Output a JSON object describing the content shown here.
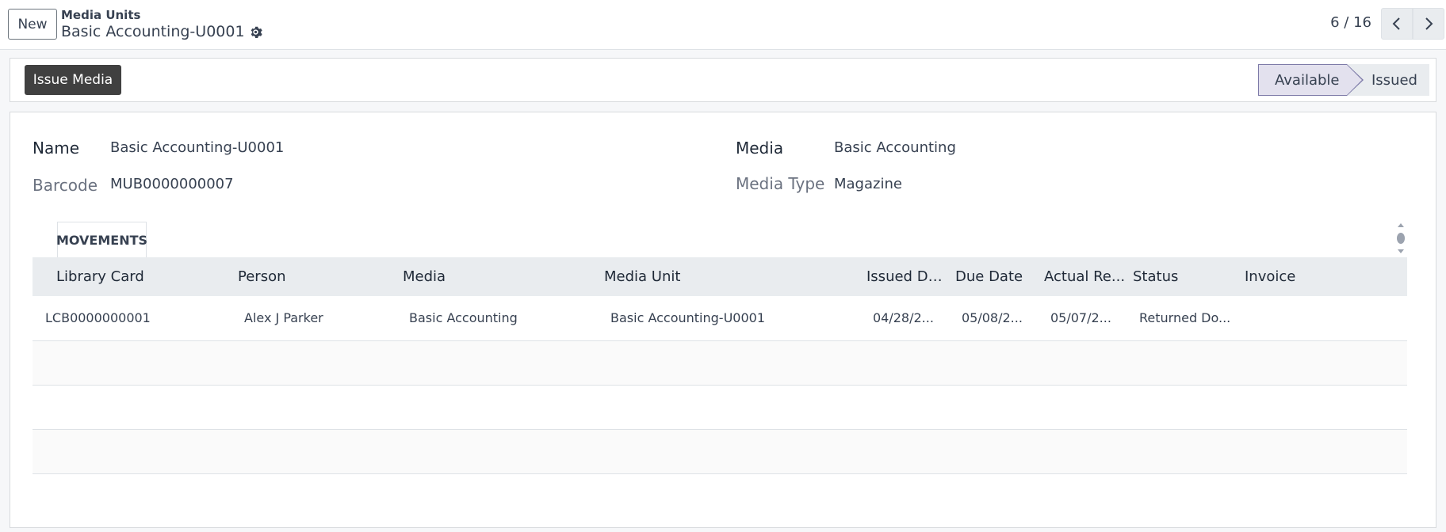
{
  "control_panel": {
    "new_label": "New",
    "breadcrumb_parent": "Media Units",
    "breadcrumb_current": "Basic Accounting-U0001",
    "pager_value": "6 / 16"
  },
  "statusbar": {
    "action_label": "Issue Media",
    "stages": [
      "Available",
      "Issued"
    ],
    "current_stage": "Available"
  },
  "form": {
    "name_label": "Name",
    "name_value": "Basic Accounting-U0001",
    "barcode_label": "Barcode",
    "barcode_value": "MUB0000000007",
    "media_label": "Media",
    "media_value": "Basic Accounting",
    "media_type_label": "Media Type",
    "media_type_value": "Magazine"
  },
  "notebook": {
    "tab_label": "MOVEMENTS",
    "columns": [
      "Library Card",
      "Person",
      "Media",
      "Media Unit",
      "Issued Da...",
      "Due Date",
      "Actual Re...",
      "Status",
      "Invoice"
    ],
    "rows": [
      [
        "LCB0000000001",
        "Alex J Parker",
        "Basic Accounting",
        "Basic Accounting-U0001",
        "04/28/2...",
        "05/08/2...",
        "05/07/2...",
        "Returned Do...",
        ""
      ]
    ]
  },
  "colors": {
    "accent_stage": "#e3e1ee",
    "primary_button": "#404040",
    "header_bg": "#e9ecef"
  }
}
